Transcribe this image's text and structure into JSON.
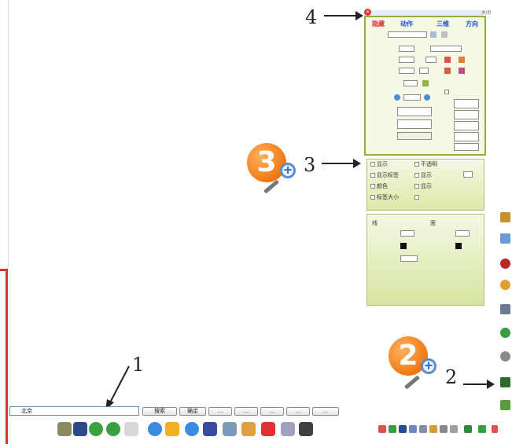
{
  "annotations": {
    "label_1": "1",
    "label_2": "2",
    "label_3": "3",
    "label_4": "4",
    "badge_2": "2",
    "badge_3": "3",
    "lens": "+"
  },
  "panel_top": {
    "headers": [
      "隐藏",
      "动作",
      "三维",
      "方向"
    ],
    "close": "×",
    "corner_label": "关闭"
  },
  "panel_middle": {
    "options": [
      "显示",
      "不透明",
      "显示标签",
      "显示",
      "颜色",
      "显示",
      "标签大小"
    ]
  },
  "panel_bottom": {
    "col1": "线",
    "col2": "面"
  },
  "input": {
    "value": "北京"
  },
  "buttons": [
    "搜索",
    "确定",
    "...",
    "...",
    "...",
    "...",
    "..."
  ],
  "colors": {
    "panel_green": "#e2ecb0",
    "panel_border": "#8fb040",
    "badge_orange": "#f07810",
    "header_red": "#e03030",
    "header_blue": "#2050c0"
  },
  "icons": {
    "right_column": [
      "map-icon",
      "road-sign-icon",
      "help-icon",
      "person-icon",
      "film-icon",
      "globe-icon",
      "camera-icon",
      "measure-icon",
      "cube-icon"
    ],
    "toolbar": [
      "settings-icon",
      "grid-icon",
      "back-icon",
      "forward-icon",
      "refresh-icon",
      "info-icon",
      "add-icon",
      "locate-icon",
      "photo-icon",
      "ruler-icon",
      "marker-icon",
      "pencil-icon",
      "draw-icon",
      "trash-icon"
    ],
    "bottom_right": [
      "play-icon",
      "person-icon",
      "chart-icon",
      "layers-icon",
      "select-icon",
      "camera-icon",
      "copy-icon",
      "share-icon",
      "tree-icon"
    ]
  }
}
